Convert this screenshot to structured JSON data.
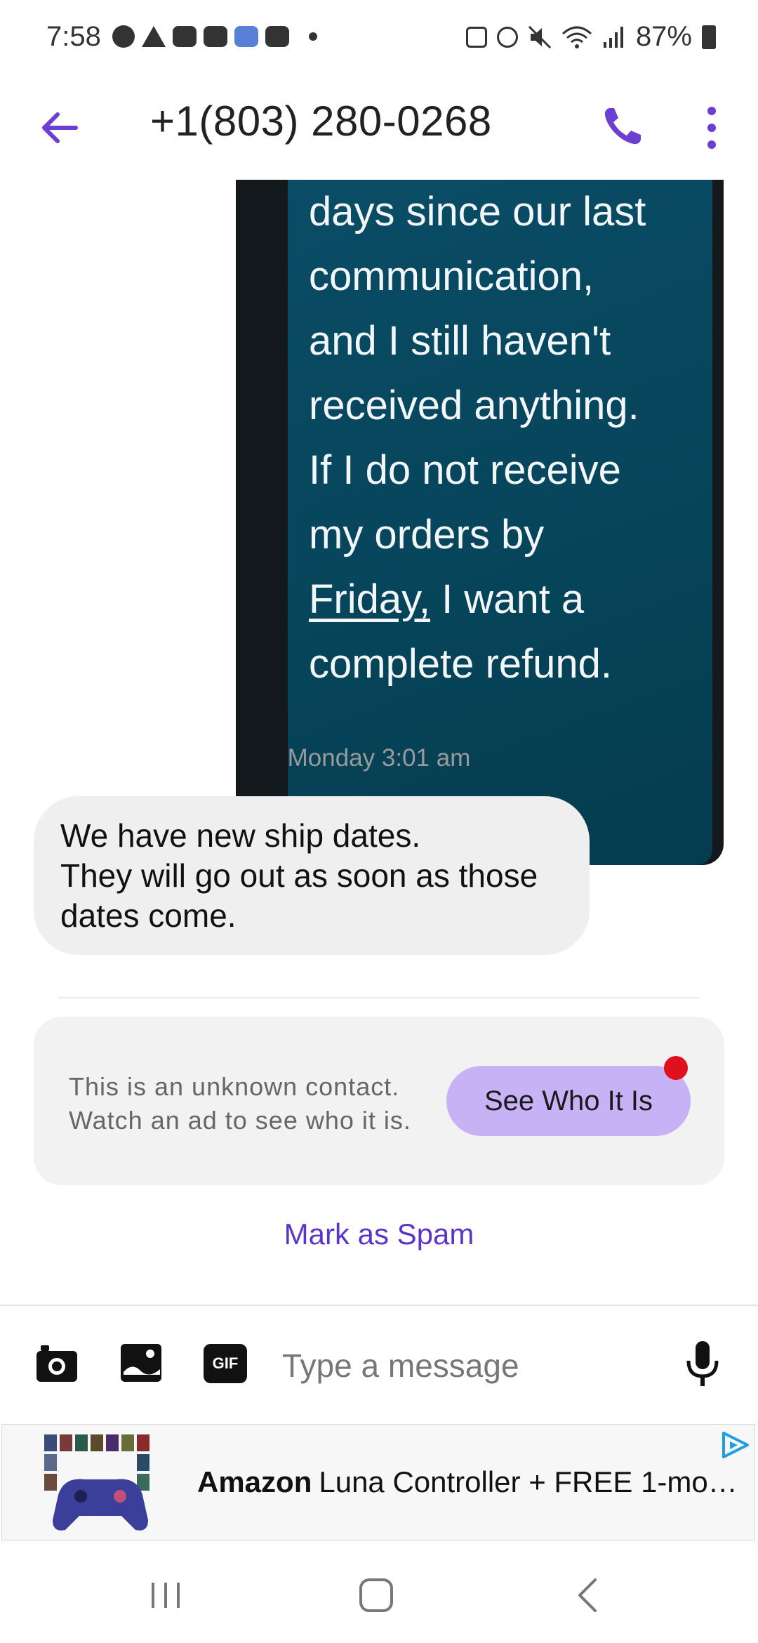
{
  "status_bar": {
    "time": "7:58",
    "battery": "87%",
    "left_icons": [
      "messenger-icon",
      "alert-icon",
      "youtube-icon",
      "youtube-icon",
      "app-icon",
      "youtube-icon",
      "dot-icon"
    ],
    "right_icons": [
      "nfc-icon",
      "alarm-icon",
      "mute-icon",
      "wifi-icon",
      "signal-icon",
      "battery-icon"
    ]
  },
  "header": {
    "title": "+1(803) 280-0268",
    "accent_color": "#6a3fd1"
  },
  "conversation": {
    "sent_message": {
      "lines": [
        "days since our last",
        "communication,",
        "and I still haven't",
        "received anything.",
        "If I do not receive",
        "my orders by"
      ],
      "link_text": "Friday,",
      "after_link": " I want a",
      "last_line": "complete refund."
    },
    "timestamp": "Monday 3:01 am",
    "received_message": {
      "lines": [
        "We have new ship dates.",
        "They will go out as soon as those",
        "dates come."
      ]
    }
  },
  "unknown_contact": {
    "line1": "This is an unknown contact.",
    "line2": "Watch an ad to see who it is.",
    "button_label": "See Who It Is"
  },
  "spam_link": "Mark as Spam",
  "compose": {
    "placeholder": "Type a message",
    "gif_label": "GIF"
  },
  "ad": {
    "brand": "Amazon",
    "text": "Luna Controller + FREE 1-mont..."
  }
}
